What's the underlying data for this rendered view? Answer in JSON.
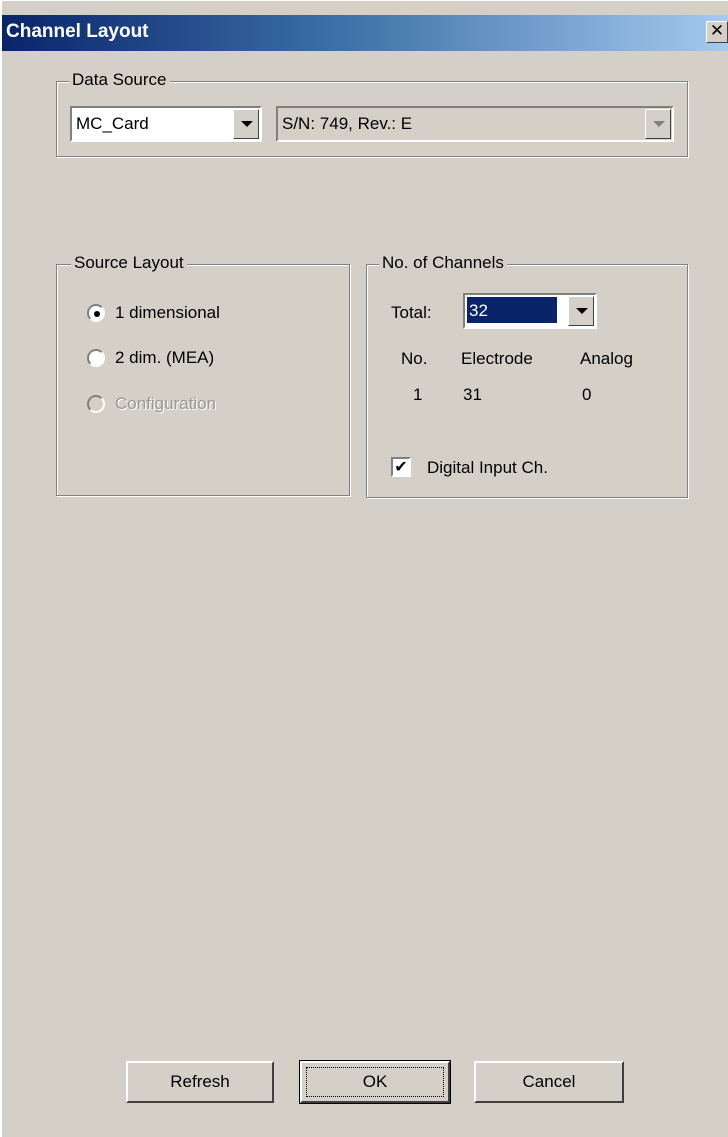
{
  "window": {
    "title": "Channel Layout",
    "close_glyph": "✕"
  },
  "data_source": {
    "legend": "Data Source",
    "source_value": "MC_Card",
    "device_value": "S/N: 749, Rev.: E"
  },
  "source_layout": {
    "legend": "Source Layout",
    "options": [
      {
        "label": "1 dimensional",
        "selected": true,
        "enabled": true
      },
      {
        "label": "2 dim. (MEA)",
        "selected": false,
        "enabled": true
      },
      {
        "label": "Configuration",
        "selected": false,
        "enabled": false
      }
    ]
  },
  "channels": {
    "legend": "No. of Channels",
    "total_label": "Total:",
    "total_value": "32",
    "table_headers": [
      "No.",
      "Electrode",
      "Analog"
    ],
    "table_values": [
      "1",
      "31",
      "0"
    ],
    "digital_input_label": "Digital Input Ch.",
    "digital_input_checked": true,
    "check_glyph": "✔"
  },
  "buttons": {
    "refresh": "Refresh",
    "ok": "OK",
    "cancel": "Cancel"
  },
  "colors": {
    "dialog_bg": "#d4d0c8",
    "title_bg": "#0a246a",
    "selection_bg": "#0a246a"
  }
}
